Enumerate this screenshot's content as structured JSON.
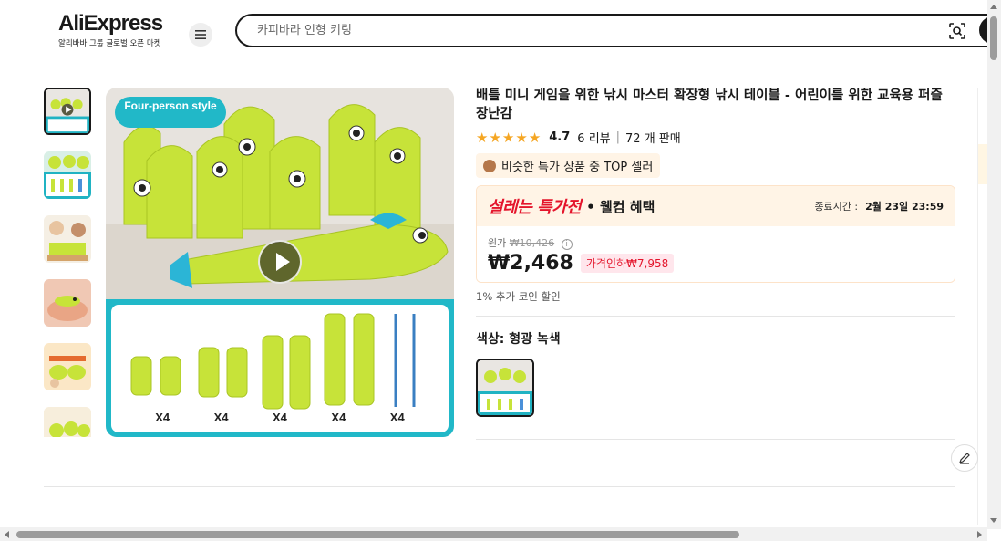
{
  "header": {
    "logo_text": "AliExpress",
    "logo_tagline": "알리바바 그룹 글로벌 오픈 마켓",
    "search_placeholder": "카피바라 인형 키링"
  },
  "gallery": {
    "badge": "Four-person style",
    "labels": [
      "X4",
      "X4",
      "X4",
      "X4",
      "X4"
    ]
  },
  "product": {
    "title": "배틀 미니 게임을 위한 낚시 마스터 확장형 낚시 테이블 - 어린이를 위한 교육용 퍼즐 장난감",
    "rating": "4.7",
    "reviews": "6 리뷰",
    "sold": "72 개 판매",
    "top_seller": "비슷한 특가 상품 중 TOP 셀러",
    "deal_brand": "설레는 특가전",
    "deal_sub": "• 웰컴 혜택",
    "deal_end_label": "종료시간 :",
    "deal_end_time": "2월 23일 23:59",
    "original_label": "원가",
    "original_price": "₩10,426",
    "price": "₩2,468",
    "discount": "가격인하₩7,958",
    "coin_text": "1% 추가 코인 할인",
    "color_label": "색상: 형광 녹색"
  },
  "colors": {
    "accent_red": "#e4142b",
    "fish_green": "#c7e339",
    "teal": "#21b8c8"
  }
}
